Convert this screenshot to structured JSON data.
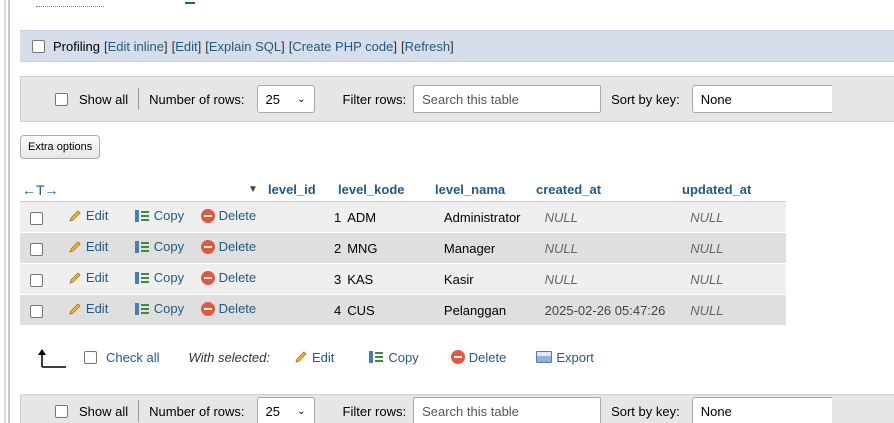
{
  "profiling": {
    "label": "Profiling",
    "links": [
      "Edit inline",
      "Edit",
      "Explain SQL",
      "Create PHP code",
      "Refresh"
    ]
  },
  "nav_top": {
    "show_all": "Show all",
    "rows_label": "Number of rows:",
    "rows_value": "25",
    "filter_label": "Filter rows:",
    "filter_placeholder": "Search this table",
    "sort_label": "Sort by key:",
    "sort_value": "None"
  },
  "nav_bottom": {
    "show_all": "Show all",
    "rows_label": "Number of rows:",
    "rows_value": "25",
    "filter_label": "Filter rows:",
    "filter_placeholder": "Search this table",
    "sort_label": "Sort by key:",
    "sort_value": "None"
  },
  "extra_options": "Extra options",
  "table": {
    "columns": [
      "level_id",
      "level_kode",
      "level_nama",
      "created_at",
      "updated_at"
    ],
    "actions": {
      "edit": "Edit",
      "copy": "Copy",
      "delete": "Delete"
    },
    "rows": [
      {
        "level_id": "1",
        "level_kode": "ADM",
        "level_nama": "Administrator",
        "created_at": "NULL",
        "updated_at": "NULL"
      },
      {
        "level_id": "2",
        "level_kode": "MNG",
        "level_nama": "Manager",
        "created_at": "NULL",
        "updated_at": "NULL"
      },
      {
        "level_id": "3",
        "level_kode": "KAS",
        "level_nama": "Kasir",
        "created_at": "NULL",
        "updated_at": "NULL"
      },
      {
        "level_id": "4",
        "level_kode": "CUS",
        "level_nama": "Pelanggan",
        "created_at": "2025-02-26 05:47:26",
        "updated_at": "NULL"
      }
    ]
  },
  "with_selected": {
    "check_all": "Check all",
    "label": "With selected:",
    "edit": "Edit",
    "copy": "Copy",
    "delete": "Delete",
    "export": "Export"
  },
  "colors": {
    "link": "#235a81",
    "profiling_bg": "#d5deea",
    "nav_bg": "#e6e6e6",
    "row_odd": "#efefef",
    "row_even": "#dfdfdf",
    "delete": "#e4573f"
  }
}
